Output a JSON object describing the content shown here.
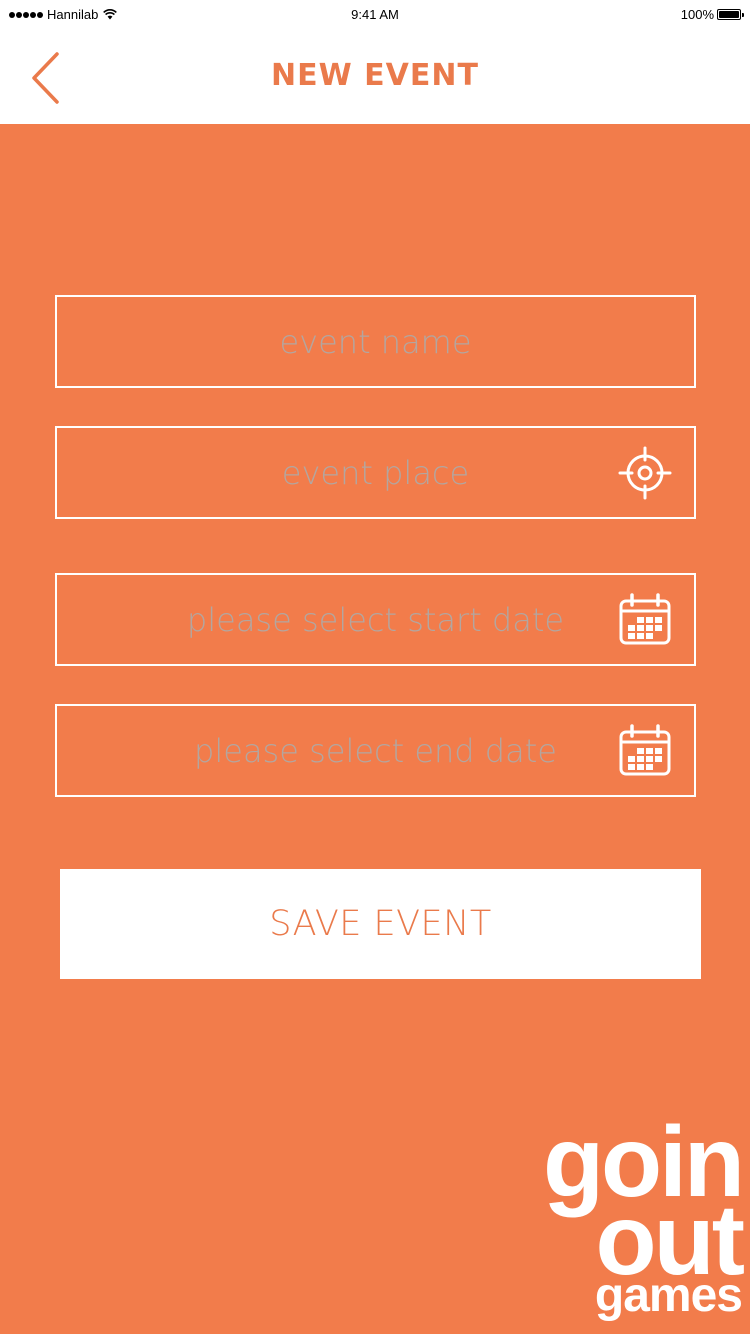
{
  "status_bar": {
    "carrier": "Hannilab",
    "time": "9:41 AM",
    "battery": "100%"
  },
  "nav": {
    "title": "NEW EVENT",
    "back_icon": "chevron-left-icon"
  },
  "form": {
    "event_name_placeholder": "event name",
    "event_place_placeholder": "event place",
    "start_date_placeholder": "please select start date",
    "end_date_placeholder": "please select end date",
    "location_icon": "crosshair-icon",
    "calendar_icon": "calendar-icon",
    "save_label": "SAVE EVENT"
  },
  "logo": {
    "line1": "goin",
    "line2": "out",
    "line3": "games"
  },
  "colors": {
    "background": "#f27c4b",
    "accent": "#ea7a4b",
    "white": "#ffffff",
    "placeholder": "#b3a6a0"
  }
}
